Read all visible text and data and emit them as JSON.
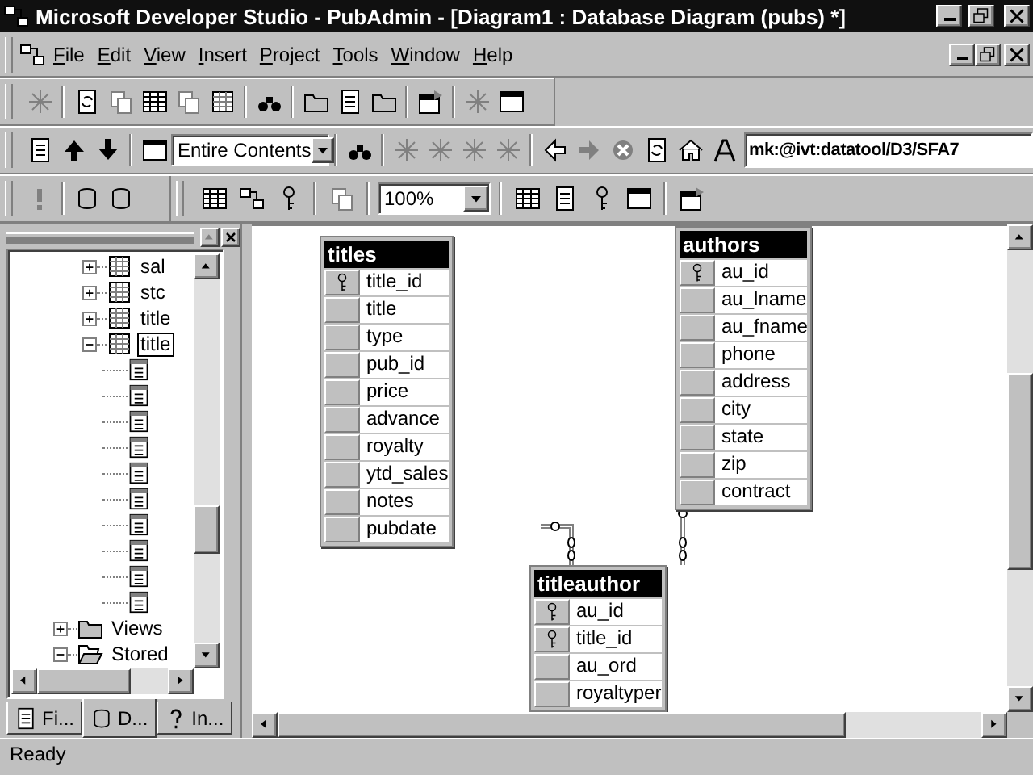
{
  "window": {
    "title": "Microsoft Developer Studio - PubAdmin - [Diagram1 : Database Diagram (pubs) *]"
  },
  "menu": [
    "File",
    "Edit",
    "View",
    "Insert",
    "Project",
    "Tools",
    "Window",
    "Help"
  ],
  "toolbar_2": {
    "find_scope": "Entire Contents",
    "address": "mk:@ivt:datatool/D3/SFA7"
  },
  "toolbar_3": {
    "zoom": "100%"
  },
  "workspace": {
    "tree": [
      {
        "children": [
          {
            "kind": "table",
            "label": "sal",
            "expanded": false,
            "selected": false
          },
          {
            "kind": "table",
            "label": "stc",
            "expanded": false,
            "selected": false
          },
          {
            "kind": "table",
            "label": "title",
            "expanded": false,
            "selected": false
          },
          {
            "kind": "table",
            "label": "title",
            "expanded": true,
            "selected": true,
            "children": [
              {
                "kind": "column"
              },
              {
                "kind": "column"
              },
              {
                "kind": "column"
              },
              {
                "kind": "column"
              },
              {
                "kind": "column"
              },
              {
                "kind": "column"
              },
              {
                "kind": "column"
              },
              {
                "kind": "column"
              },
              {
                "kind": "column"
              },
              {
                "kind": "column"
              }
            ]
          }
        ]
      },
      {
        "kind": "folder",
        "label": "Views",
        "expanded": false,
        "selected": false
      },
      {
        "kind": "folder",
        "label": "Stored",
        "expanded": true,
        "selected": false
      }
    ],
    "tabs": [
      {
        "label": "Fi...",
        "kind": "file",
        "selected": false
      },
      {
        "label": "D...",
        "kind": "data",
        "selected": true
      },
      {
        "label": "In...",
        "kind": "info",
        "selected": false
      }
    ]
  },
  "diagram": {
    "tables": [
      {
        "name": "titles",
        "columns": [
          {
            "name": "title_id",
            "key": true
          },
          {
            "name": "title",
            "key": false
          },
          {
            "name": "type",
            "key": false
          },
          {
            "name": "pub_id",
            "key": false
          },
          {
            "name": "price",
            "key": false
          },
          {
            "name": "advance",
            "key": false
          },
          {
            "name": "royalty",
            "key": false
          },
          {
            "name": "ytd_sales",
            "key": false
          },
          {
            "name": "notes",
            "key": false
          },
          {
            "name": "pubdate",
            "key": false
          }
        ]
      },
      {
        "name": "authors",
        "columns": [
          {
            "name": "au_id",
            "key": true
          },
          {
            "name": "au_lname",
            "key": false
          },
          {
            "name": "au_fname",
            "key": false
          },
          {
            "name": "phone",
            "key": false
          },
          {
            "name": "address",
            "key": false
          },
          {
            "name": "city",
            "key": false
          },
          {
            "name": "state",
            "key": false
          },
          {
            "name": "zip",
            "key": false
          },
          {
            "name": "contract",
            "key": false
          }
        ]
      },
      {
        "name": "titleauthor",
        "columns": [
          {
            "name": "au_id",
            "key": true
          },
          {
            "name": "title_id",
            "key": true
          },
          {
            "name": "au_ord",
            "key": false
          },
          {
            "name": "royaltyper",
            "key": false
          }
        ]
      }
    ]
  },
  "status_bar": "Ready"
}
